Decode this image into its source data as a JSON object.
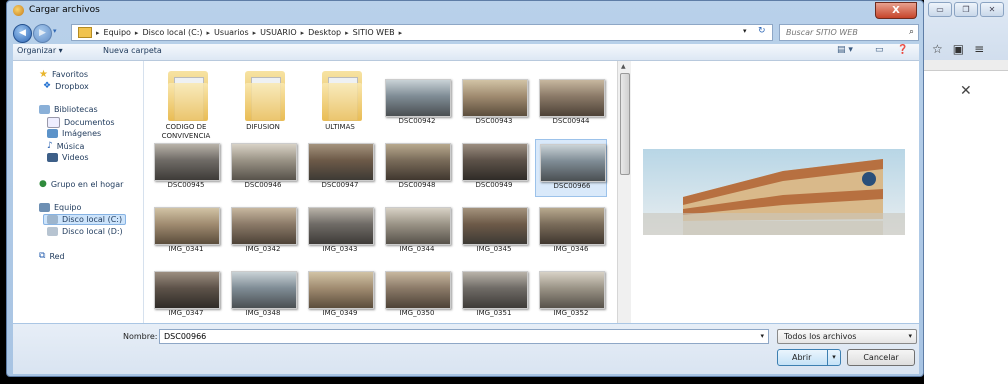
{
  "dialog": {
    "title": "Cargar archivos",
    "close_label": "X"
  },
  "address": {
    "crumbs": [
      "Equipo",
      "Disco local (C:)",
      "Usuarios",
      "USUARIO",
      "Desktop",
      "SITIO WEB"
    ],
    "search_placeholder": "Buscar SITIO WEB"
  },
  "command_bar": {
    "organize": "Organizar ▾",
    "new_folder": "Nueva carpeta"
  },
  "nav": {
    "favorites": "Favoritos",
    "dropbox": "Dropbox",
    "libraries": "Bibliotecas",
    "documents": "Documentos",
    "images": "Imágenes",
    "music": "Música",
    "videos": "Videos",
    "homegroup": "Grupo en el hogar",
    "computer": "Equipo",
    "disk_c": "Disco local (C:)",
    "disk_d": "Disco local (D:)",
    "network": "Red"
  },
  "files": [
    {
      "name": "CODIGO DE CONVIVENCIA",
      "type": "folder"
    },
    {
      "name": "DIFUSION",
      "type": "folder"
    },
    {
      "name": "ULTIMAS",
      "type": "folder"
    },
    {
      "name": "DSC00942",
      "type": "image"
    },
    {
      "name": "DSC00943",
      "type": "image"
    },
    {
      "name": "DSC00944",
      "type": "image"
    },
    {
      "name": "DSC00945",
      "type": "image"
    },
    {
      "name": "DSC00946",
      "type": "image"
    },
    {
      "name": "DSC00947",
      "type": "image"
    },
    {
      "name": "DSC00948",
      "type": "image"
    },
    {
      "name": "DSC00949",
      "type": "image"
    },
    {
      "name": "DSC00966",
      "type": "image",
      "selected": true
    },
    {
      "name": "IMG_0341",
      "type": "image"
    },
    {
      "name": "IMG_0342",
      "type": "image"
    },
    {
      "name": "IMG_0343",
      "type": "image"
    },
    {
      "name": "IMG_0344",
      "type": "image"
    },
    {
      "name": "IMG_0345",
      "type": "image"
    },
    {
      "name": "IMG_0346",
      "type": "image"
    },
    {
      "name": "IMG_0347",
      "type": "image"
    },
    {
      "name": "IMG_0348",
      "type": "image"
    },
    {
      "name": "IMG_0349",
      "type": "image"
    },
    {
      "name": "IMG_0350",
      "type": "image"
    },
    {
      "name": "IMG_0351",
      "type": "image"
    },
    {
      "name": "IMG_0352",
      "type": "image"
    }
  ],
  "bottom": {
    "filename_label": "Nombre:",
    "filename_value": "DSC00966",
    "filetype": "Todos los archivos",
    "open": "Abrir",
    "cancel": "Cancelar"
  },
  "colors": {
    "accent": "#3c7fb1",
    "selection": "#d9e9fa",
    "dialog_frame": "#b9d1ea"
  }
}
